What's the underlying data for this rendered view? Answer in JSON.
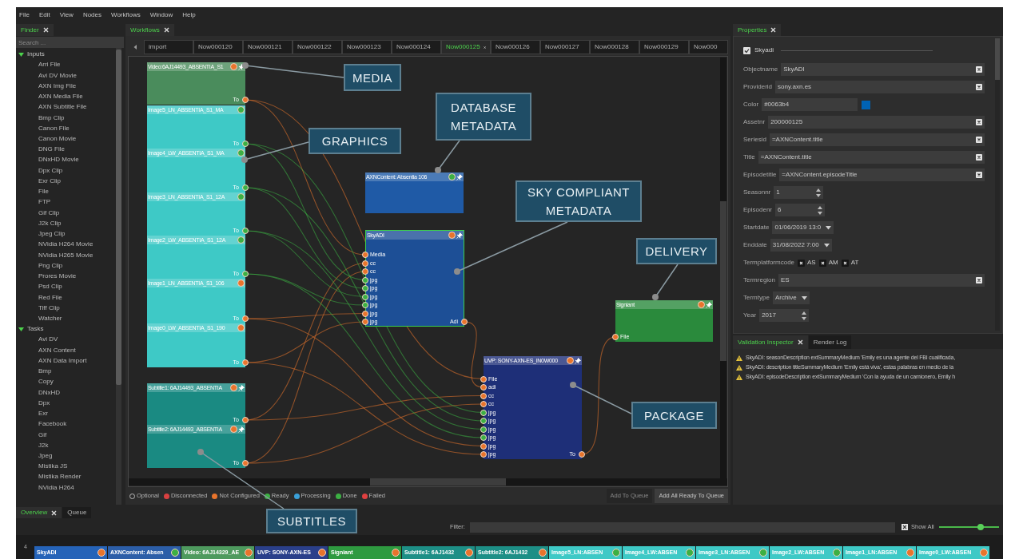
{
  "menu": [
    "File",
    "Edit",
    "View",
    "Nodes",
    "Workflows",
    "Window",
    "Help"
  ],
  "finder": {
    "tabs": [
      {
        "label": "Finder",
        "selected": true
      }
    ],
    "search_placeholder": "Search ...",
    "tree": [
      {
        "label": "Inputs",
        "expanded": true,
        "children": [
          {
            "label": "Arri File"
          },
          {
            "label": "Avi DV Movie"
          },
          {
            "label": "AXN Img File"
          },
          {
            "label": "AXN Media File"
          },
          {
            "label": "AXN Subtitle File"
          },
          {
            "label": "Bmp Clip"
          },
          {
            "label": "Canon File"
          },
          {
            "label": "Canon Movie"
          },
          {
            "label": "DNG File"
          },
          {
            "label": "DNxHD Movie"
          },
          {
            "label": "Dpx Clip"
          },
          {
            "label": "Exr Clip"
          },
          {
            "label": "File"
          },
          {
            "label": "FTP"
          },
          {
            "label": "Gif Clip"
          },
          {
            "label": "J2k Clip"
          },
          {
            "label": "Jpeg Clip"
          },
          {
            "label": "NVidia H264 Movie"
          },
          {
            "label": "NVidia H265 Movie"
          },
          {
            "label": "Png Clip"
          },
          {
            "label": "Prores Movie"
          },
          {
            "label": "Psd Clip"
          },
          {
            "label": "Red File"
          },
          {
            "label": "Tiff Clip"
          },
          {
            "label": "Watcher"
          }
        ]
      },
      {
        "label": "Tasks",
        "expanded": true,
        "children": [
          {
            "label": "Avi DV"
          },
          {
            "label": "AXN Content"
          },
          {
            "label": "AXN Data Import"
          },
          {
            "label": "Bmp"
          },
          {
            "label": "Copy"
          },
          {
            "label": "DNxHD"
          },
          {
            "label": "Dpx"
          },
          {
            "label": "Exr"
          },
          {
            "label": "Facebook"
          },
          {
            "label": "Gif"
          },
          {
            "label": "J2k"
          },
          {
            "label": "Jpeg"
          },
          {
            "label": "Mistika JS"
          },
          {
            "label": "Mistika Render"
          },
          {
            "label": "NVidia H264"
          }
        ]
      }
    ]
  },
  "workflows": {
    "tabs": [
      {
        "label": "Workflows",
        "selected": true
      }
    ],
    "workflow_tabs": [
      {
        "label": "import",
        "selected": false
      },
      {
        "label": "Now000120",
        "selected": false
      },
      {
        "label": "Now000121",
        "selected": false
      },
      {
        "label": "Now000122",
        "selected": false
      },
      {
        "label": "Now000123",
        "selected": false
      },
      {
        "label": "Now000124",
        "selected": false
      },
      {
        "label": "Now000125",
        "selected": true
      },
      {
        "label": "Now000126",
        "selected": false
      },
      {
        "label": "Now000127",
        "selected": false
      },
      {
        "label": "Now000128",
        "selected": false
      },
      {
        "label": "Now000129",
        "selected": false
      },
      {
        "label": "Now000",
        "selected": false
      }
    ],
    "nodes": [
      {
        "title": "Video:6AJ14493_ABSENTIA_S1",
        "color": "#4a8c5c",
        "ready": false,
        "pinned": true,
        "selected": false,
        "output": {
          "label": "To",
          "color": "#e8742c"
        }
      },
      {
        "title": "Image5_LN_ABSENTIA_S1_MA",
        "color": "#3ec9c6",
        "ready": true,
        "pinned": false,
        "selected": false,
        "output": {
          "label": "To",
          "color": "#3cb043"
        }
      },
      {
        "title": "Image4_LW_ABSENTIA_S1_MA",
        "color": "#3ec9c6",
        "ready": true,
        "pinned": false,
        "selected": false,
        "output": {
          "label": "To",
          "color": "#3cb043"
        }
      },
      {
        "title": "Image3_LN_ABSENTIA_S1_12A",
        "color": "#3ec9c6",
        "ready": true,
        "pinned": false,
        "selected": false,
        "output": {
          "label": "To",
          "color": "#3cb043"
        }
      },
      {
        "title": "Image2_LW_ABSENTIA_S1_12A",
        "color": "#3ec9c6",
        "ready": true,
        "pinned": false,
        "selected": false,
        "output": {
          "label": "To",
          "color": "#3cb043"
        }
      },
      {
        "title": "Image1_LN_ABSENTIA_S1_106",
        "color": "#3ec9c6",
        "ready": false,
        "pinned": false,
        "selected": false,
        "output": {
          "label": "To",
          "color": "#e8742c"
        }
      },
      {
        "title": "Image0_LW_ABSENTIA_S1_190",
        "color": "#3ec9c6",
        "ready": false,
        "pinned": false,
        "selected": false,
        "output": {
          "label": "To",
          "color": "#e8742c"
        }
      },
      {
        "title": "Subtitle1: 6AJ14493_ABSENTIA",
        "color": "#1a8a82",
        "ready": false,
        "pinned": true,
        "selected": false,
        "output": {
          "label": "To",
          "color": "#e8742c"
        }
      },
      {
        "title": "Subtitle2: 6AJ14493_ABSENTIA",
        "color": "#1a8a82",
        "ready": false,
        "pinned": true,
        "selected": false,
        "output": {
          "label": "To",
          "color": "#e8742c"
        }
      },
      {
        "title": "AXNContent: Absentia 106",
        "color": "#1f5aa6",
        "ready": true,
        "pinned": true,
        "selected": false
      },
      {
        "title": "SkyADI",
        "color": "#1d4f96",
        "ready": false,
        "pinned": true,
        "selected": true,
        "inputs": [
          {
            "label": "Media",
            "color": "#e8742c"
          },
          {
            "label": "cc",
            "color": "#e8742c"
          },
          {
            "label": "cc",
            "color": "#e8742c"
          },
          {
            "label": "jpg",
            "color": "#3cb043"
          },
          {
            "label": "jpg",
            "color": "#3cb043"
          },
          {
            "label": "jpg",
            "color": "#3cb043"
          },
          {
            "label": "jpg",
            "color": "#3cb043"
          },
          {
            "label": "jpg",
            "color": "#e8742c"
          },
          {
            "label": "jpg",
            "color": "#e8742c"
          }
        ],
        "output": {
          "label": "Adi",
          "color": "#e8742c"
        }
      },
      {
        "title": "UVP: SONY-AXN-ES_IN0W000",
        "color": "#1e2f78",
        "ready": false,
        "pinned": true,
        "selected": false,
        "inputs": [
          {
            "label": "File",
            "color": "#e8742c"
          },
          {
            "label": "adi",
            "color": "#e8742c"
          },
          {
            "label": "cc",
            "color": "#e8742c"
          },
          {
            "label": "cc",
            "color": "#e8742c"
          },
          {
            "label": "jpg",
            "color": "#3cb043"
          },
          {
            "label": "jpg",
            "color": "#3cb043"
          },
          {
            "label": "jpg",
            "color": "#3cb043"
          },
          {
            "label": "jpg",
            "color": "#3cb043"
          },
          {
            "label": "jpg",
            "color": "#e8742c"
          },
          {
            "label": "jpg",
            "color": "#e8742c"
          }
        ],
        "output": {
          "label": "To",
          "color": "#e8742c"
        }
      },
      {
        "title": "Signiant",
        "color": "#2a8a3c",
        "ready": false,
        "pinned": true,
        "selected": false,
        "inputs": [
          {
            "label": "File",
            "color": "#e8742c"
          }
        ]
      }
    ],
    "legend": [
      {
        "kind": "outline",
        "label": "Optional"
      },
      {
        "kind": "dot",
        "label": "Disconnected",
        "color": "#d94040"
      },
      {
        "kind": "dot",
        "label": "Not Configured",
        "color": "#e8742c"
      },
      {
        "kind": "dot",
        "label": "Ready",
        "color": "#3cb043"
      },
      {
        "kind": "dot",
        "label": "Processing",
        "color": "#3aa0d8"
      },
      {
        "kind": "dot",
        "label": "Done",
        "color": "#3cb043"
      },
      {
        "kind": "dot",
        "label": "Failed",
        "color": "#e04040"
      }
    ],
    "buttons": [
      {
        "label": "Add To Queue",
        "disabled": true
      },
      {
        "label": "Add All Ready To Queue",
        "disabled": false
      }
    ]
  },
  "callouts": [
    {
      "label": "MEDIA"
    },
    {
      "label": "GRAPHICS"
    },
    {
      "label": "DATABASE METADATA"
    },
    {
      "label": "SKY COMPLIANT METADATA"
    },
    {
      "label": "DELIVERY"
    },
    {
      "label": "PACKAGE"
    },
    {
      "label": "SUBTITLES"
    }
  ],
  "properties": {
    "tabs": [
      {
        "label": "Properties",
        "selected": true
      }
    ],
    "header": {
      "label": "Skyadi",
      "checked": true
    },
    "fields": [
      {
        "kind": "text",
        "label": "Objectname",
        "value": "SkyADI"
      },
      {
        "kind": "text",
        "label": "Providerid",
        "value": "sony.axn.es"
      },
      {
        "kind": "color",
        "label": "Color",
        "value": "#0063b4"
      },
      {
        "kind": "text",
        "label": "Assetnr",
        "value": "200000125"
      },
      {
        "kind": "text",
        "label": "Seriesid",
        "value": "=AXNContent.title"
      },
      {
        "kind": "text",
        "label": "Title",
        "value": "=AXNContent.title"
      },
      {
        "kind": "text",
        "label": "Episodetitle",
        "value": "=AXNContent.episodeTitle"
      },
      {
        "kind": "spin",
        "label": "Seasonnr",
        "value": "1"
      },
      {
        "kind": "spin",
        "label": "Episodenr",
        "value": "6"
      },
      {
        "kind": "select",
        "label": "Startdate",
        "value": "01/06/2019 13:0"
      },
      {
        "kind": "select",
        "label": "Enddate",
        "value": "31/08/2022 7:00"
      },
      {
        "kind": "tags",
        "label": "Termplatformcode",
        "tags": [
          "AS",
          "AM",
          "AT"
        ]
      },
      {
        "kind": "text",
        "label": "Termregion",
        "value": "ES"
      },
      {
        "kind": "select",
        "label": "Termtype",
        "value": "Archive"
      },
      {
        "kind": "spin",
        "label": "Year",
        "value": "2017"
      }
    ]
  },
  "validation": {
    "tabs": [
      {
        "label": "Validation Inspector",
        "selected": true
      },
      {
        "label": "Render Log",
        "selected": false
      }
    ],
    "messages": [
      {
        "text": "SkyADI: seasonDescription extSummaryMedium 'Emily es una agente del FBI cualificada,"
      },
      {
        "text": "SkyADI: description titleSummaryMedium 'Emily está viva', estas palabras en medio de la"
      },
      {
        "text": "SkyADI: episodeDescription extSummaryMedium 'Con la ayuda de un camionero, Emily h"
      }
    ]
  },
  "overview": {
    "tabs": [
      {
        "label": "Overview",
        "selected": true
      },
      {
        "label": "Queue",
        "selected": false
      }
    ],
    "filter_label": "Filter:",
    "show_all": {
      "label": "Show All",
      "checked": true,
      "level": 0.7
    },
    "row_number": "4",
    "chips": [
      {
        "label": "SkyADI",
        "color": "#2563b8",
        "ready": false
      },
      {
        "label": "AXNContent: Absen",
        "color": "#2c5ea8",
        "ready": true
      },
      {
        "label": "Video: 6AJ14329_AE",
        "color": "#4e9a5e",
        "ready": false
      },
      {
        "label": "UVP: SONY-AXN-ES",
        "color": "#2a3f8a",
        "ready": false
      },
      {
        "label": "Signiant",
        "color": "#2e9a40",
        "ready": false
      },
      {
        "label": "Subtitle1: 6AJ1432",
        "color": "#1d8f86",
        "ready": false
      },
      {
        "label": "Subtitle2: 6AJ1432",
        "color": "#1d8f86",
        "ready": false
      },
      {
        "label": "Image5_LN:ABSEN",
        "color": "#3ec9c6",
        "ready": true
      },
      {
        "label": "Image4_LW:ABSEN",
        "color": "#3ec9c6",
        "ready": true
      },
      {
        "label": "Image3_LN:ABSEN",
        "color": "#3ec9c6",
        "ready": true
      },
      {
        "label": "Image2_LW:ABSEN",
        "color": "#3ec9c6",
        "ready": true
      },
      {
        "label": "Image1_LN:ABSEN",
        "color": "#3ec9c6",
        "ready": false
      },
      {
        "label": "Image0_LW:ABSEN",
        "color": "#3ec9c6",
        "ready": false
      }
    ]
  }
}
